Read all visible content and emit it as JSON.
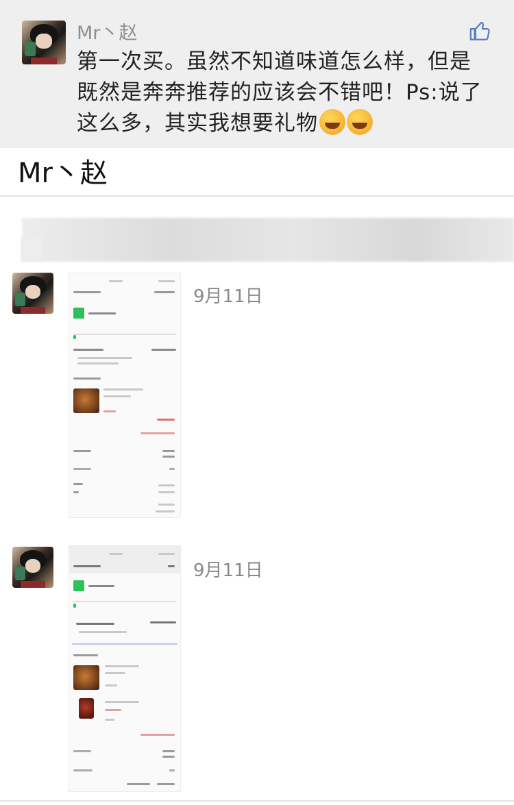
{
  "comment": {
    "author": "Mr丶赵",
    "text": "第一次买。虽然不知道味道怎么样，但是既然是奔奔推荐的应该会不错吧！Ps:说了这么多，其实我想要礼物",
    "emojis": [
      "facepalm-emoji",
      "facepalm-emoji"
    ],
    "like_icon": "thumbs-up-icon"
  },
  "profile": {
    "name": "Mr丶赵"
  },
  "posts": [
    {
      "date": "9月11日"
    },
    {
      "date": "9月11日"
    }
  ]
}
